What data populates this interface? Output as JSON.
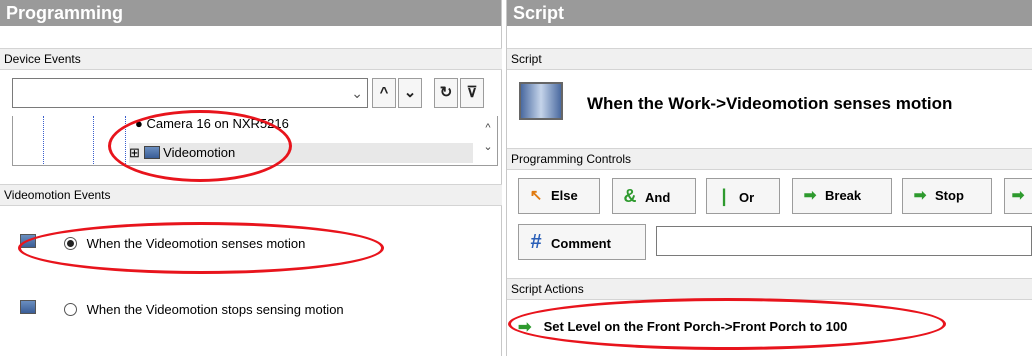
{
  "programming": {
    "title": "Programming",
    "device_events": {
      "header": "Device Events",
      "combo_value": "",
      "toolbar_icons": [
        "chevron-down-icon",
        "arrow-up-icon",
        "arrow-down-icon",
        "refresh-icon",
        "filter-icon"
      ],
      "tree": [
        {
          "label": "Camera 16 on NXR5216",
          "icon": "camera-icon"
        },
        {
          "label": "Videomotion",
          "icon": "monitor-icon",
          "expander": "⊞",
          "selected": true
        }
      ]
    },
    "videomotion_events": {
      "header": "Videomotion Events",
      "options": [
        {
          "label": "When the Videomotion senses motion",
          "checked": true
        },
        {
          "label": "When the Videomotion stops sensing motion",
          "checked": false
        }
      ]
    }
  },
  "script": {
    "title": "Script",
    "subheader": "Script",
    "trigger_text": "When the Work->Videomotion senses motion",
    "programming_controls": {
      "header": "Programming Controls",
      "buttons": [
        {
          "label": "Else",
          "icon": "else-icon",
          "glyph": "↖"
        },
        {
          "label": "And",
          "icon": "and-icon",
          "glyph": "&"
        },
        {
          "label": "Or",
          "icon": "or-icon",
          "glyph": "|"
        },
        {
          "label": "Break",
          "icon": "break-arrow-icon",
          "glyph": "➡"
        },
        {
          "label": "Stop",
          "icon": "stop-arrow-icon",
          "glyph": "➡"
        }
      ],
      "comment_label": "Comment",
      "comment_glyph": "#",
      "comment_value": ""
    },
    "script_actions": {
      "header": "Script Actions",
      "items": [
        {
          "label": "Set Level on the Front Porch->Front Porch to 100"
        }
      ]
    }
  },
  "colors": {
    "title_bar": "#9a9a9a",
    "annotation_red": "#e8141c",
    "action_green": "#2e9a2e",
    "and_green": "#2e9a2e",
    "else_orange": "#e07a10"
  }
}
